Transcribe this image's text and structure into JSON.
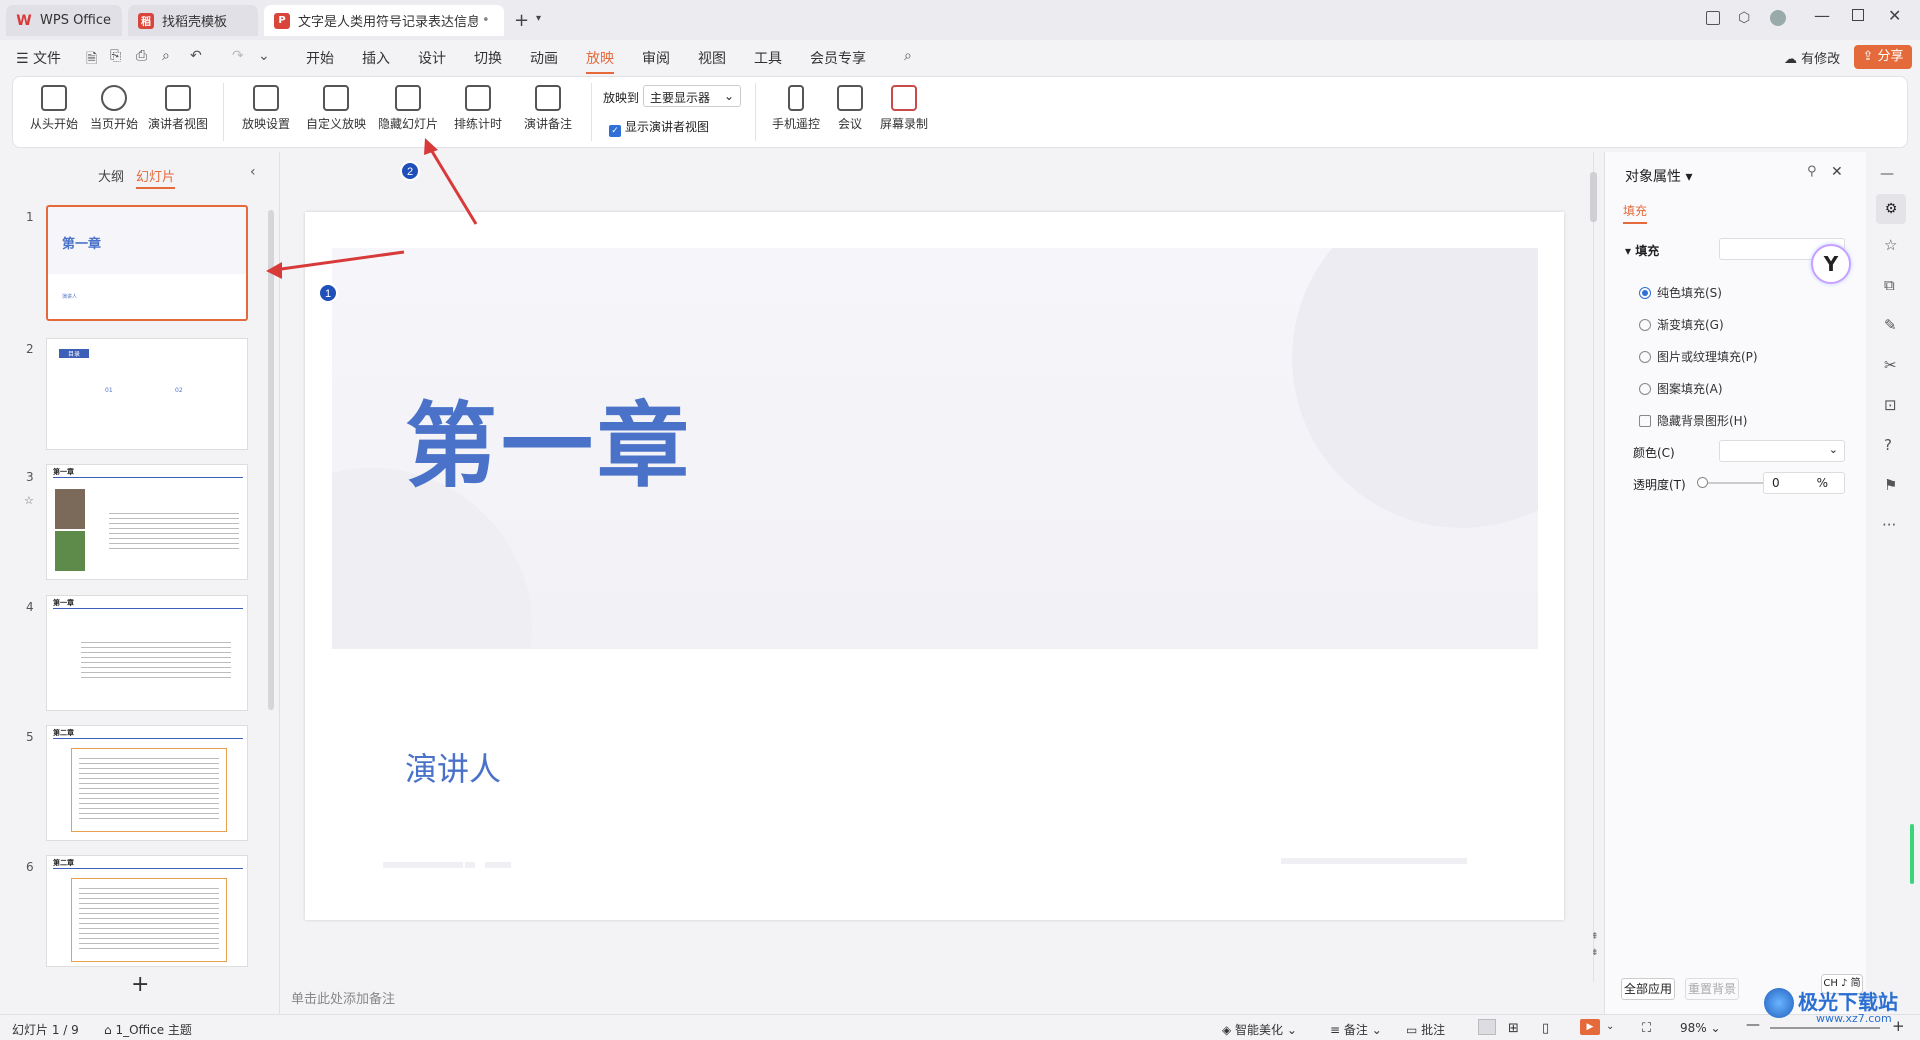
{
  "tabs": [
    {
      "label": "WPS Office",
      "icon": "wps-logo-icon"
    },
    {
      "label": "找稻壳模板",
      "icon": "docer-icon"
    },
    {
      "label": "文字是人类用符号记录表达信息以",
      "icon": "ppt-file-icon"
    }
  ],
  "menu": {
    "file": "文件",
    "items": [
      "开始",
      "插入",
      "设计",
      "切换",
      "动画",
      "放映",
      "审阅",
      "视图",
      "工具",
      "会员专享"
    ],
    "active": "放映",
    "modified": "有修改",
    "share": "分享"
  },
  "ribbon": {
    "buttons": [
      "从头开始",
      "当页开始",
      "演讲者视图",
      "放映设置",
      "自定义放映",
      "隐藏幻灯片",
      "排练计时",
      "演讲备注"
    ],
    "show_on_label": "放映到",
    "show_on_value": "主要显示器",
    "presenter_view_checkbox": "显示演讲者视图",
    "right_buttons": [
      "手机遥控",
      "会议",
      "屏幕录制"
    ]
  },
  "left_pane": {
    "tab_outline": "大纲",
    "tab_slides": "幻灯片",
    "add": "+",
    "slides": [
      {
        "num": "1",
        "title": "第一章",
        "sub": "演讲人"
      },
      {
        "num": "2",
        "title": "目录",
        "items": [
          "01",
          "02"
        ]
      },
      {
        "num": "3",
        "title": "第一章"
      },
      {
        "num": "4",
        "title": "第一章"
      },
      {
        "num": "5",
        "title": "第二章"
      },
      {
        "num": "6",
        "title": "第二章"
      }
    ]
  },
  "slide": {
    "title": "第一章",
    "subtitle": "演讲人"
  },
  "annotations": [
    "1",
    "2"
  ],
  "notes_placeholder": "单击此处添加备注",
  "right_pane": {
    "title": "对象属性",
    "tab": "填充",
    "section": "填充",
    "options": [
      "纯色填充(S)",
      "渐变填充(G)",
      "图片或纹理填充(P)",
      "图案填充(A)"
    ],
    "selected_option": "纯色填充(S)",
    "hide_bg": "隐藏背景图形(H)",
    "color_label": "颜色(C)",
    "transparency_label": "透明度(T)",
    "transparency_value": "0",
    "transparency_unit": "%",
    "apply_all": "全部应用",
    "reset_bg": "重置背景",
    "ime": "CH ♪ 简"
  },
  "status": {
    "slide_info": "幻灯片 1 / 9",
    "theme": "1_Office 主题",
    "beautify": "智能美化",
    "notes": "备注",
    "comments": "批注",
    "zoom": "98%"
  },
  "watermark": "极光下载站",
  "watermark_url": "www.xz7.com",
  "colors": {
    "accent": "#e56a3b",
    "slide_title": "#4a72c9",
    "annotation_arrow": "#d83a3a",
    "badge": "#1f4fb8"
  }
}
